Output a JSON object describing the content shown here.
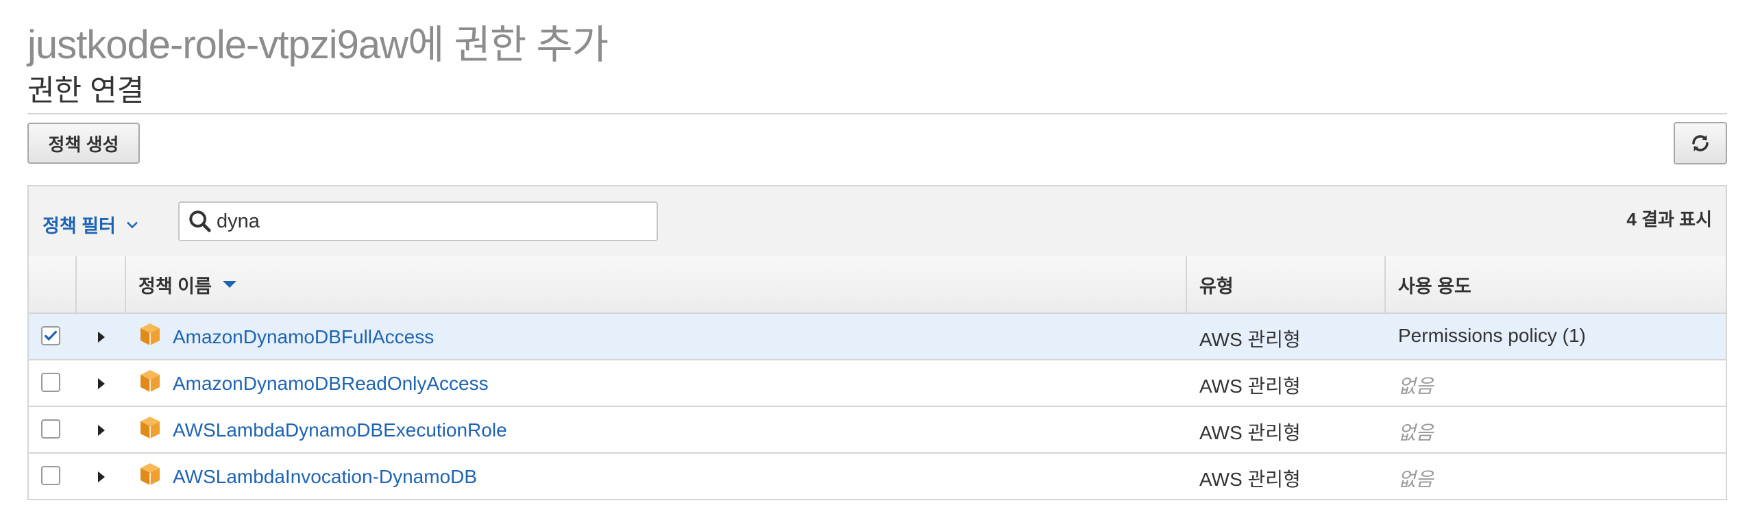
{
  "page": {
    "title": "justkode-role-vtpzi9aw에 권한 추가",
    "section_title": "권한 연결",
    "create_policy_label": "정책 생성",
    "refresh_icon": "refresh-icon"
  },
  "filter": {
    "label": "정책 필터",
    "search_value": "dyna",
    "result_count": "4 결과 표시"
  },
  "table": {
    "columns": {
      "name": "정책 이름",
      "type": "유형",
      "usage": "사용 용도"
    },
    "rows": [
      {
        "name": "AmazonDynamoDBFullAccess",
        "type": "AWS 관리형",
        "usage": "Permissions policy (1)",
        "checked": true
      },
      {
        "name": "AmazonDynamoDBReadOnlyAccess",
        "type": "AWS 관리형",
        "usage": "없음",
        "checked": false
      },
      {
        "name": "AWSLambdaDynamoDBExecutionRole",
        "type": "AWS 관리형",
        "usage": "없음",
        "checked": false
      },
      {
        "name": "AWSLambdaInvocation-DynamoDB",
        "type": "AWS 관리형",
        "usage": "없음",
        "checked": false
      }
    ]
  },
  "colors": {
    "link": "#1e64b4",
    "selected_row": "#e6f0fa",
    "policy_icon": "#f0a030"
  }
}
